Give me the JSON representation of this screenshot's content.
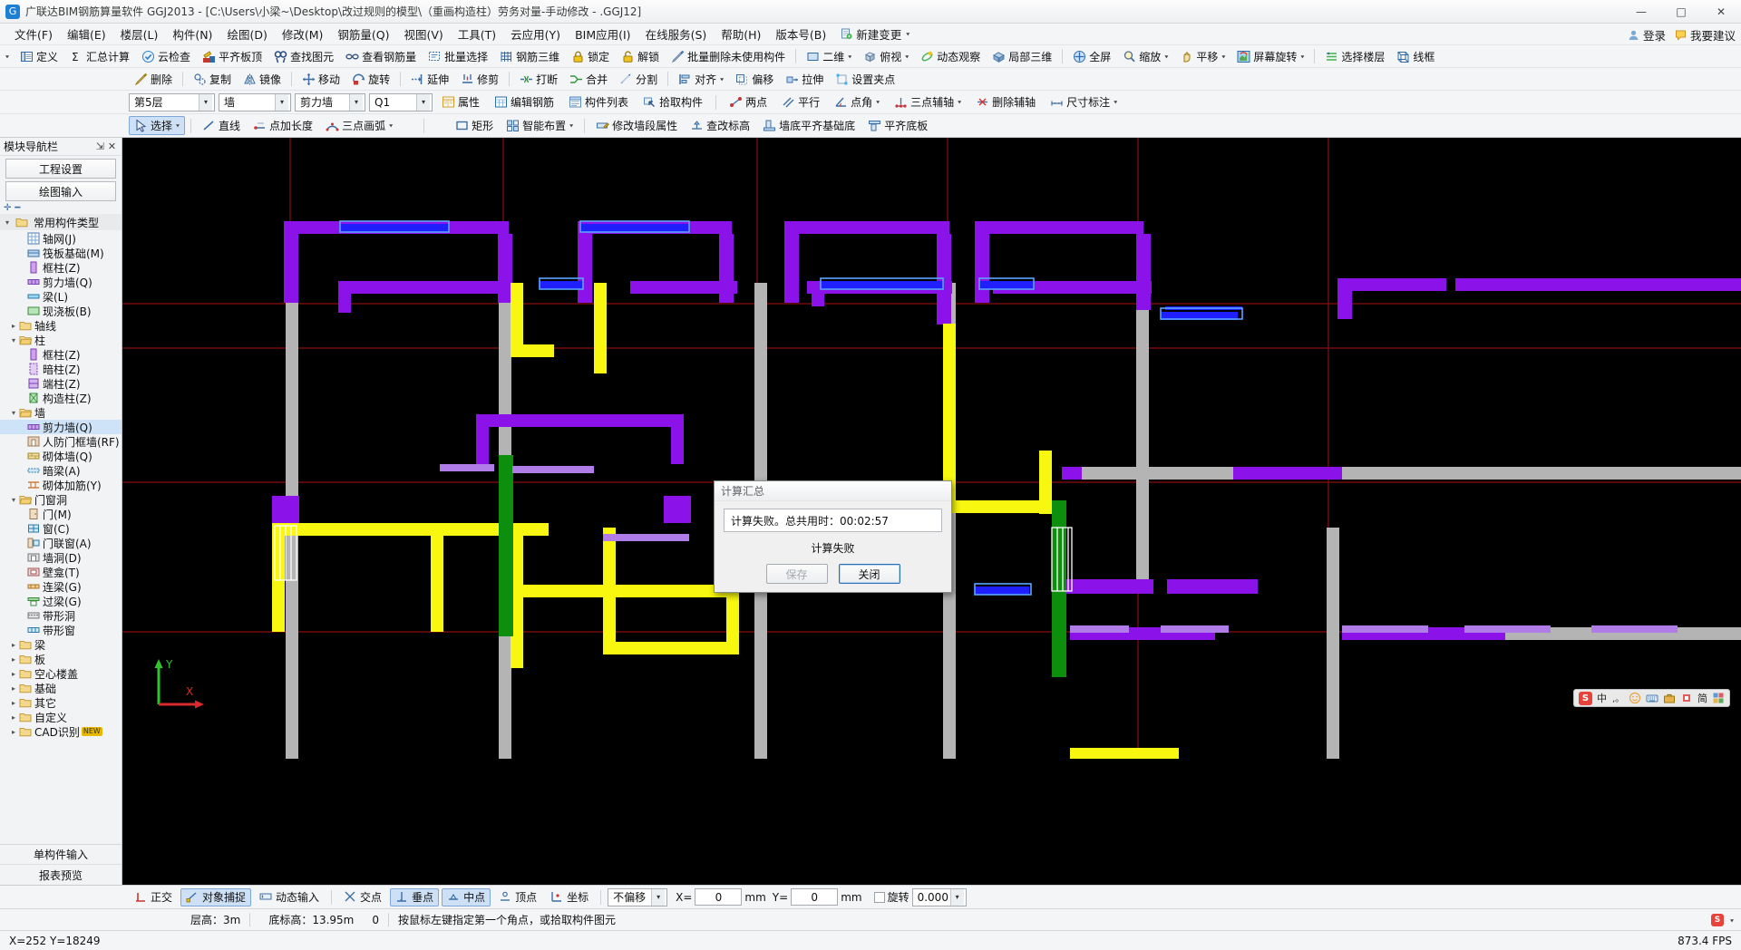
{
  "window": {
    "title": "广联达BIM钢筋算量软件 GGJ2013 - [C:\\Users\\小梁~\\Desktop\\改过规则的模型\\（重画构造柱）劳务对量-手动修改 - .GGJ12]",
    "minimize": "—",
    "maximize": "□",
    "close": "✕"
  },
  "menubar": {
    "items": [
      {
        "label": "文件(F)"
      },
      {
        "label": "编辑(E)"
      },
      {
        "label": "楼层(L)"
      },
      {
        "label": "构件(N)"
      },
      {
        "label": "绘图(D)"
      },
      {
        "label": "修改(M)"
      },
      {
        "label": "钢筋量(Q)"
      },
      {
        "label": "视图(V)"
      },
      {
        "label": "工具(T)"
      },
      {
        "label": "云应用(Y)"
      },
      {
        "label": "BIM应用(I)"
      },
      {
        "label": "在线服务(S)"
      },
      {
        "label": "帮助(H)"
      },
      {
        "label": "版本号(B)"
      }
    ],
    "extra": {
      "label": "新建变更",
      "icon": "new-change-icon",
      "caret": "▾"
    },
    "right": [
      {
        "label": "登录",
        "icon": "login-icon"
      },
      {
        "label": "我要建议",
        "icon": "suggest-icon"
      }
    ]
  },
  "toolbar_main": {
    "overflow_caret": "▾",
    "items": [
      {
        "label": "定义",
        "icon": "define-icon"
      },
      {
        "label": "汇总计算",
        "icon": "sigma-icon"
      },
      {
        "label": "云检查",
        "icon": "cloud-check-icon"
      },
      {
        "label": "平齐板顶",
        "icon": "align-slab-top-icon"
      },
      {
        "label": "查找图元",
        "icon": "find-element-icon"
      },
      {
        "label": "查看钢筋量",
        "icon": "view-rebar-icon"
      },
      {
        "label": "批量选择",
        "icon": "batch-select-icon"
      },
      {
        "label": "钢筋三维",
        "icon": "rebar-3d-icon"
      },
      {
        "label": "锁定",
        "icon": "lock-icon"
      },
      {
        "label": "解锁",
        "icon": "unlock-icon"
      },
      {
        "label": "批量删除未使用构件",
        "icon": "batch-delete-icon"
      }
    ],
    "view_items": [
      {
        "label": "二维",
        "icon": "2d-icon",
        "caret": "▾"
      },
      {
        "label": "俯视",
        "icon": "topview-icon",
        "caret": "▾"
      },
      {
        "label": "动态观察",
        "icon": "orbit-icon"
      },
      {
        "label": "局部三维",
        "icon": "local-3d-icon"
      }
    ],
    "nav_items": [
      {
        "label": "全屏",
        "icon": "fullscreen-icon"
      },
      {
        "label": "缩放",
        "icon": "zoom-icon",
        "caret": "▾"
      },
      {
        "label": "平移",
        "icon": "pan-icon",
        "caret": "▾"
      },
      {
        "label": "屏幕旋转",
        "icon": "screen-rotate-icon",
        "caret": "▾"
      }
    ],
    "tail_items": [
      {
        "label": "选择楼层",
        "icon": "select-floor-icon"
      },
      {
        "label": "线框",
        "icon": "wireframe-icon"
      }
    ]
  },
  "toolbar_edit": {
    "items": [
      {
        "label": "删除",
        "icon": "delete-icon"
      },
      {
        "label": "复制",
        "icon": "copy-icon"
      },
      {
        "label": "镜像",
        "icon": "mirror-icon"
      },
      {
        "label": "移动",
        "icon": "move-icon"
      },
      {
        "label": "旋转",
        "icon": "rotate-icon"
      },
      {
        "label": "延伸",
        "icon": "extend-icon"
      },
      {
        "label": "修剪",
        "icon": "trim-icon"
      },
      {
        "label": "打断",
        "icon": "break-icon"
      },
      {
        "label": "合并",
        "icon": "merge-icon"
      },
      {
        "label": "分割",
        "icon": "split-icon"
      },
      {
        "label": "对齐",
        "icon": "align-icon",
        "caret": "▾"
      },
      {
        "label": "偏移",
        "icon": "offset-icon"
      },
      {
        "label": "拉伸",
        "icon": "stretch-icon"
      },
      {
        "label": "设置夹点",
        "icon": "set-grip-icon"
      }
    ]
  },
  "selector_row": {
    "floor": {
      "value": "第5层",
      "caret": "▾"
    },
    "category": {
      "value": "墙",
      "caret": "▾"
    },
    "type": {
      "value": "剪力墙",
      "caret": "▾"
    },
    "member": {
      "value": "Q1",
      "caret": "▾"
    },
    "buttons": [
      {
        "label": "属性",
        "icon": "property-icon"
      },
      {
        "label": "编辑钢筋",
        "icon": "edit-rebar-icon"
      },
      {
        "label": "构件列表",
        "icon": "member-list-icon"
      },
      {
        "label": "拾取构件",
        "icon": "pick-member-icon"
      }
    ],
    "axis_buttons": [
      {
        "label": "两点",
        "icon": "two-point-icon"
      },
      {
        "label": "平行",
        "icon": "parallel-icon"
      },
      {
        "label": "点角",
        "icon": "point-angle-icon",
        "caret": "▾"
      },
      {
        "label": "三点辅轴",
        "icon": "three-point-axis-icon",
        "caret": "▾"
      },
      {
        "label": "删除辅轴",
        "icon": "delete-axis-icon"
      },
      {
        "label": "尺寸标注",
        "icon": "dimension-icon",
        "caret": "▾"
      }
    ]
  },
  "draw_row": {
    "select": {
      "label": "选择",
      "icon": "cursor-icon",
      "caret": "▾"
    },
    "tools": [
      {
        "label": "直线",
        "icon": "line-icon"
      },
      {
        "label": "点加长度",
        "icon": "point-length-icon"
      },
      {
        "label": "三点画弧",
        "icon": "three-point-arc-icon",
        "caret": "▾"
      }
    ],
    "shape_tools": [
      {
        "label": "矩形",
        "icon": "rectangle-icon"
      },
      {
        "label": "智能布置",
        "icon": "smart-layout-icon",
        "caret": "▾"
      }
    ],
    "wall_tools": [
      {
        "label": "修改墙段属性",
        "icon": "edit-wall-seg-icon"
      },
      {
        "label": "查改标高",
        "icon": "check-elevation-icon"
      },
      {
        "label": "墙底平齐基础底",
        "icon": "wall-base-align-icon"
      },
      {
        "label": "平齐底板",
        "icon": "align-bottom-slab-icon"
      }
    ]
  },
  "sidebar": {
    "header": {
      "title": "模块导航栏",
      "pin_icon": "pin-icon",
      "close_icon": "close-icon"
    },
    "top_buttons": [
      {
        "label": "工程设置"
      },
      {
        "label": "绘图输入"
      }
    ],
    "splitter": {
      "expand_icon": "expand-icon",
      "collapse_icon": "collapse-icon"
    },
    "section": {
      "label": "常用构件类型",
      "icon": "folder-icon",
      "twisty": "▾"
    },
    "tree": [
      {
        "label": "轴网(J)",
        "level": 2,
        "icon": "grid-icon",
        "twisty": "",
        "selected": false
      },
      {
        "label": "筏板基础(M)",
        "level": 2,
        "icon": "raft-icon",
        "twisty": "",
        "selected": false
      },
      {
        "label": "框柱(Z)",
        "level": 2,
        "icon": "column-icon",
        "twisty": "",
        "selected": false
      },
      {
        "label": "剪力墙(Q)",
        "level": 2,
        "icon": "wall-icon",
        "twisty": "",
        "selected": false
      },
      {
        "label": "梁(L)",
        "level": 2,
        "icon": "beam-icon",
        "twisty": "",
        "selected": false
      },
      {
        "label": "现浇板(B)",
        "level": 2,
        "icon": "slab-icon",
        "twisty": "",
        "selected": false
      },
      {
        "label": "轴线",
        "level": 1,
        "icon": "folder-icon",
        "twisty": "▸",
        "selected": false
      },
      {
        "label": "柱",
        "level": 1,
        "icon": "folder-open-icon",
        "twisty": "▾",
        "selected": false
      },
      {
        "label": "框柱(Z)",
        "level": 2,
        "icon": "column-icon",
        "twisty": "",
        "selected": false
      },
      {
        "label": "暗柱(Z)",
        "level": 2,
        "icon": "hidden-column-icon",
        "twisty": "",
        "selected": false
      },
      {
        "label": "端柱(Z)",
        "level": 2,
        "icon": "end-column-icon",
        "twisty": "",
        "selected": false
      },
      {
        "label": "构造柱(Z)",
        "level": 2,
        "icon": "struct-column-icon",
        "twisty": "",
        "selected": false
      },
      {
        "label": "墙",
        "level": 1,
        "icon": "folder-open-icon",
        "twisty": "▾",
        "selected": false
      },
      {
        "label": "剪力墙(Q)",
        "level": 2,
        "icon": "wall-icon",
        "twisty": "",
        "selected": true
      },
      {
        "label": "人防门框墙(RF)",
        "level": 2,
        "icon": "door-frame-wall-icon",
        "twisty": "",
        "selected": false
      },
      {
        "label": "砌体墙(Q)",
        "level": 2,
        "icon": "masonry-wall-icon",
        "twisty": "",
        "selected": false
      },
      {
        "label": "暗梁(A)",
        "level": 2,
        "icon": "hidden-beam-icon",
        "twisty": "",
        "selected": false
      },
      {
        "label": "砌体加筋(Y)",
        "level": 2,
        "icon": "masonry-rebar-icon",
        "twisty": "",
        "selected": false
      },
      {
        "label": "门窗洞",
        "level": 1,
        "icon": "folder-open-icon",
        "twisty": "▾",
        "selected": false
      },
      {
        "label": "门(M)",
        "level": 2,
        "icon": "door-icon",
        "twisty": "",
        "selected": false
      },
      {
        "label": "窗(C)",
        "level": 2,
        "icon": "window-icon",
        "twisty": "",
        "selected": false
      },
      {
        "label": "门联窗(A)",
        "level": 2,
        "icon": "door-window-icon",
        "twisty": "",
        "selected": false
      },
      {
        "label": "墙洞(D)",
        "level": 2,
        "icon": "wall-hole-icon",
        "twisty": "",
        "selected": false
      },
      {
        "label": "壁龛(T)",
        "level": 2,
        "icon": "niche-icon",
        "twisty": "",
        "selected": false
      },
      {
        "label": "连梁(G)",
        "level": 2,
        "icon": "coupling-beam-icon",
        "twisty": "",
        "selected": false
      },
      {
        "label": "过梁(G)",
        "level": 2,
        "icon": "lintel-icon",
        "twisty": "",
        "selected": false
      },
      {
        "label": "带形洞",
        "level": 2,
        "icon": "strip-hole-icon",
        "twisty": "",
        "selected": false
      },
      {
        "label": "带形窗",
        "level": 2,
        "icon": "strip-window-icon",
        "twisty": "",
        "selected": false
      },
      {
        "label": "梁",
        "level": 1,
        "icon": "folder-icon",
        "twisty": "▸",
        "selected": false
      },
      {
        "label": "板",
        "level": 1,
        "icon": "folder-icon",
        "twisty": "▸",
        "selected": false
      },
      {
        "label": "空心楼盖",
        "level": 1,
        "icon": "folder-icon",
        "twisty": "▸",
        "selected": false
      },
      {
        "label": "基础",
        "level": 1,
        "icon": "folder-icon",
        "twisty": "▸",
        "selected": false
      },
      {
        "label": "其它",
        "level": 1,
        "icon": "folder-icon",
        "twisty": "▸",
        "selected": false
      },
      {
        "label": "自定义",
        "level": 1,
        "icon": "folder-icon",
        "twisty": "▸",
        "selected": false
      },
      {
        "label": "CAD识别",
        "level": 1,
        "icon": "folder-icon",
        "twisty": "▸",
        "selected": false,
        "badge": "NEW"
      }
    ],
    "bottom_buttons": [
      {
        "label": "单构件输入"
      },
      {
        "label": "报表预览"
      }
    ]
  },
  "dialog": {
    "title": "计算汇总",
    "message": "计算失败。总共用时：00:02:57",
    "status": "计算失败",
    "save_button": "保存",
    "close_button": "关闭"
  },
  "ime": {
    "logo": "S",
    "mode": "中",
    "items": [
      "punct-icon",
      "smiley-icon",
      "keyboard-icon",
      "toolbox-icon",
      "skin-icon",
      "simple-label",
      "settings-icon"
    ],
    "simple_label": "简"
  },
  "status_row": {
    "buttons": [
      {
        "label": "正交",
        "icon": "ortho-icon",
        "active": false
      },
      {
        "label": "对象捕捉",
        "icon": "osnap-icon",
        "active": true
      },
      {
        "label": "动态输入",
        "icon": "dyninput-icon",
        "active": false
      },
      {
        "label": "交点",
        "icon": "intersection-icon",
        "active": false
      },
      {
        "label": "垂点",
        "icon": "perpendicular-icon",
        "active": true
      },
      {
        "label": "中点",
        "icon": "midpoint-icon",
        "active": true
      },
      {
        "label": "顶点",
        "icon": "vertex-icon",
        "active": false
      },
      {
        "label": "坐标",
        "icon": "coordinate-icon",
        "active": false
      }
    ],
    "offset": {
      "value": "不偏移",
      "caret": "▾"
    },
    "x_label": "X=",
    "x_value": "0",
    "x_unit": "mm",
    "y_label": "Y=",
    "y_value": "0",
    "y_unit": "mm",
    "rotate_checkbox_label": "旋转",
    "rotate_value": "0.000",
    "rotate_caret": "▾"
  },
  "info_bar": {
    "cells": [
      "层高：3m",
      "底标高：13.95m",
      "0"
    ],
    "hint": "按鼠标左键指定第一个角点，或拾取构件图元"
  },
  "bottom_bar": {
    "coords": "X=252  Y=18249",
    "right_logo": "S",
    "right_caret": "▾",
    "fps": "873.4  FPS"
  }
}
